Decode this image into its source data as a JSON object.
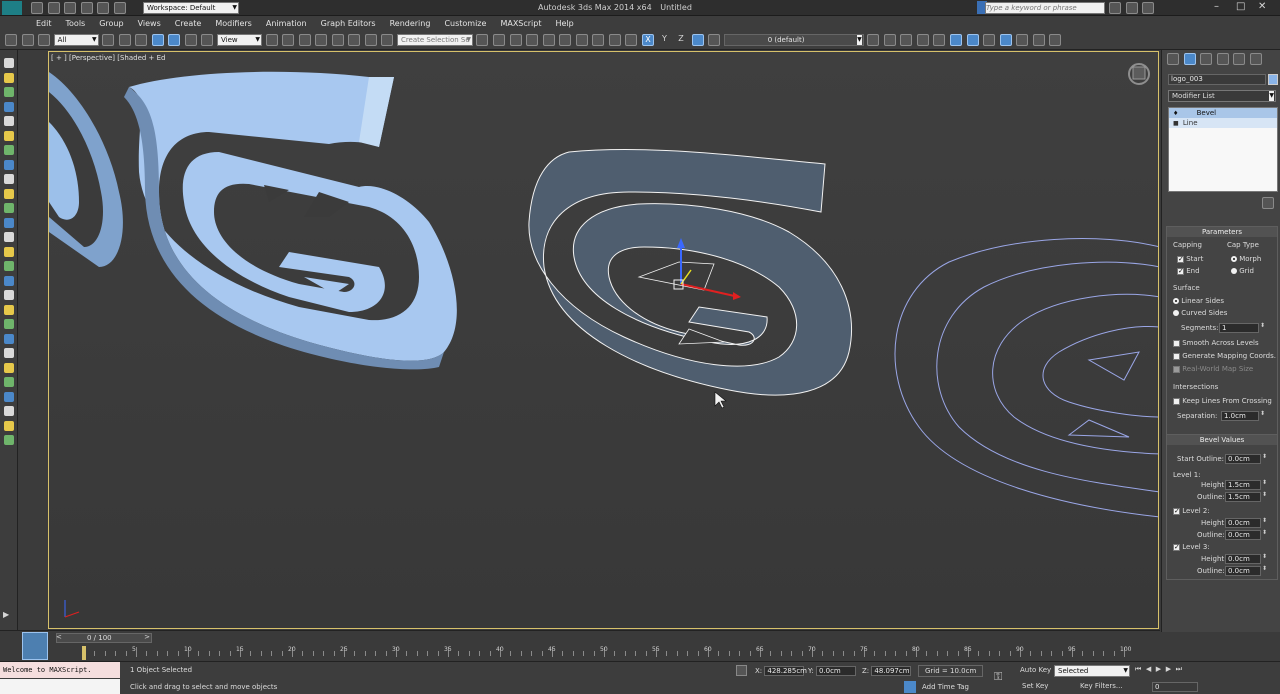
{
  "app": {
    "title": "Autodesk 3ds Max 2014 x64",
    "document": "Untitled",
    "workspace": "Workspace: Default",
    "search_placeholder": "Type a keyword or phrase"
  },
  "menu": [
    "Edit",
    "Tools",
    "Group",
    "Views",
    "Create",
    "Modifiers",
    "Animation",
    "Graph Editors",
    "Rendering",
    "Customize",
    "MAXScript",
    "Help"
  ],
  "toolbar": {
    "selection_filter": "All",
    "reference_coord": "View",
    "named_selection": "Create Selection Se",
    "axes": [
      "X",
      "Y",
      "Z"
    ],
    "layer": "0 (default)"
  },
  "viewport": {
    "label": "[ + ] [Perspective] [Shaded + Ed"
  },
  "panel": {
    "object_name": "logo_003",
    "modifier_list": "Modifier List",
    "stack": [
      "Bevel",
      "Line"
    ],
    "parameters_title": "Parameters",
    "capping_label": "Capping",
    "cap_start": "Start",
    "cap_end": "End",
    "cap_type_label": "Cap Type",
    "cap_morph": "Morph",
    "cap_grid": "Grid",
    "surface_label": "Surface",
    "linear_sides": "Linear Sides",
    "curved_sides": "Curved Sides",
    "segments_label": "Segments:",
    "segments_value": "1",
    "smooth_across": "Smooth Across Levels",
    "gen_mapping": "Generate Mapping Coords.",
    "real_world": "Real-World Map Size",
    "intersections_label": "Intersections",
    "keep_lines": "Keep Lines From Crossing",
    "separation_label": "Separation:",
    "separation_value": "1.0cm",
    "bevel_values_title": "Bevel Values",
    "start_outline_label": "Start Outline:",
    "start_outline_value": "0.0cm",
    "level1_label": "Level 1:",
    "level1_height": "1.5cm",
    "level1_outline": "1.5cm",
    "level2_label": "Level 2:",
    "level2_height": "0.0cm",
    "level2_outline": "0.0cm",
    "level3_label": "Level 3:",
    "level3_height": "0.0cm",
    "level3_outline": "0.0cm",
    "height_label": "Height:",
    "outline_label": "Outline:"
  },
  "timeline": {
    "frame_counter": "0 / 100",
    "ticks": [
      "0",
      "5",
      "10",
      "15",
      "20",
      "25",
      "30",
      "35",
      "40",
      "45",
      "50",
      "55",
      "60",
      "65",
      "70",
      "75",
      "80",
      "85",
      "90",
      "95",
      "100"
    ]
  },
  "status": {
    "maxscript_welcome": "Welcome to MAXScript.",
    "selection_info": "1 Object Selected",
    "prompt": "Click and drag to select and move objects",
    "x_label": "X:",
    "x_value": "428.285cm",
    "y_label": "Y:",
    "y_value": "0.0cm",
    "z_label": "Z:",
    "z_value": "48.097cm",
    "grid": "Grid = 10.0cm",
    "add_time_tag": "Add Time Tag",
    "auto_key": "Auto Key",
    "set_key": "Set Key",
    "key_mode": "Selected",
    "key_filters": "Key Filters...",
    "frame": "0"
  }
}
